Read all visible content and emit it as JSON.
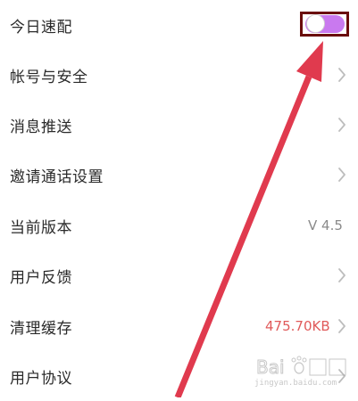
{
  "settings": {
    "items": [
      {
        "label": "今日速配",
        "type": "toggle",
        "toggle_on": true
      },
      {
        "label": "帐号与安全",
        "type": "link"
      },
      {
        "label": "消息推送",
        "type": "link"
      },
      {
        "label": "邀请通话设置",
        "type": "link"
      },
      {
        "label": "当前版本",
        "type": "value",
        "value": "V 4.5"
      },
      {
        "label": "用户反馈",
        "type": "link"
      },
      {
        "label": "清理缓存",
        "type": "value-link",
        "value": "475.70KB"
      },
      {
        "label": "用户协议",
        "type": "link"
      }
    ]
  },
  "colors": {
    "toggle_on": "#c979ef",
    "annotation": "#e03a4e",
    "highlight_border": "#6a0c0c",
    "cache_value": "#e05a5a"
  },
  "watermark": {
    "text": "jingyan.baidu.com"
  },
  "icons": [
    "chevron-right-icon",
    "toggle-switch",
    "baidu-paw-icon"
  ]
}
